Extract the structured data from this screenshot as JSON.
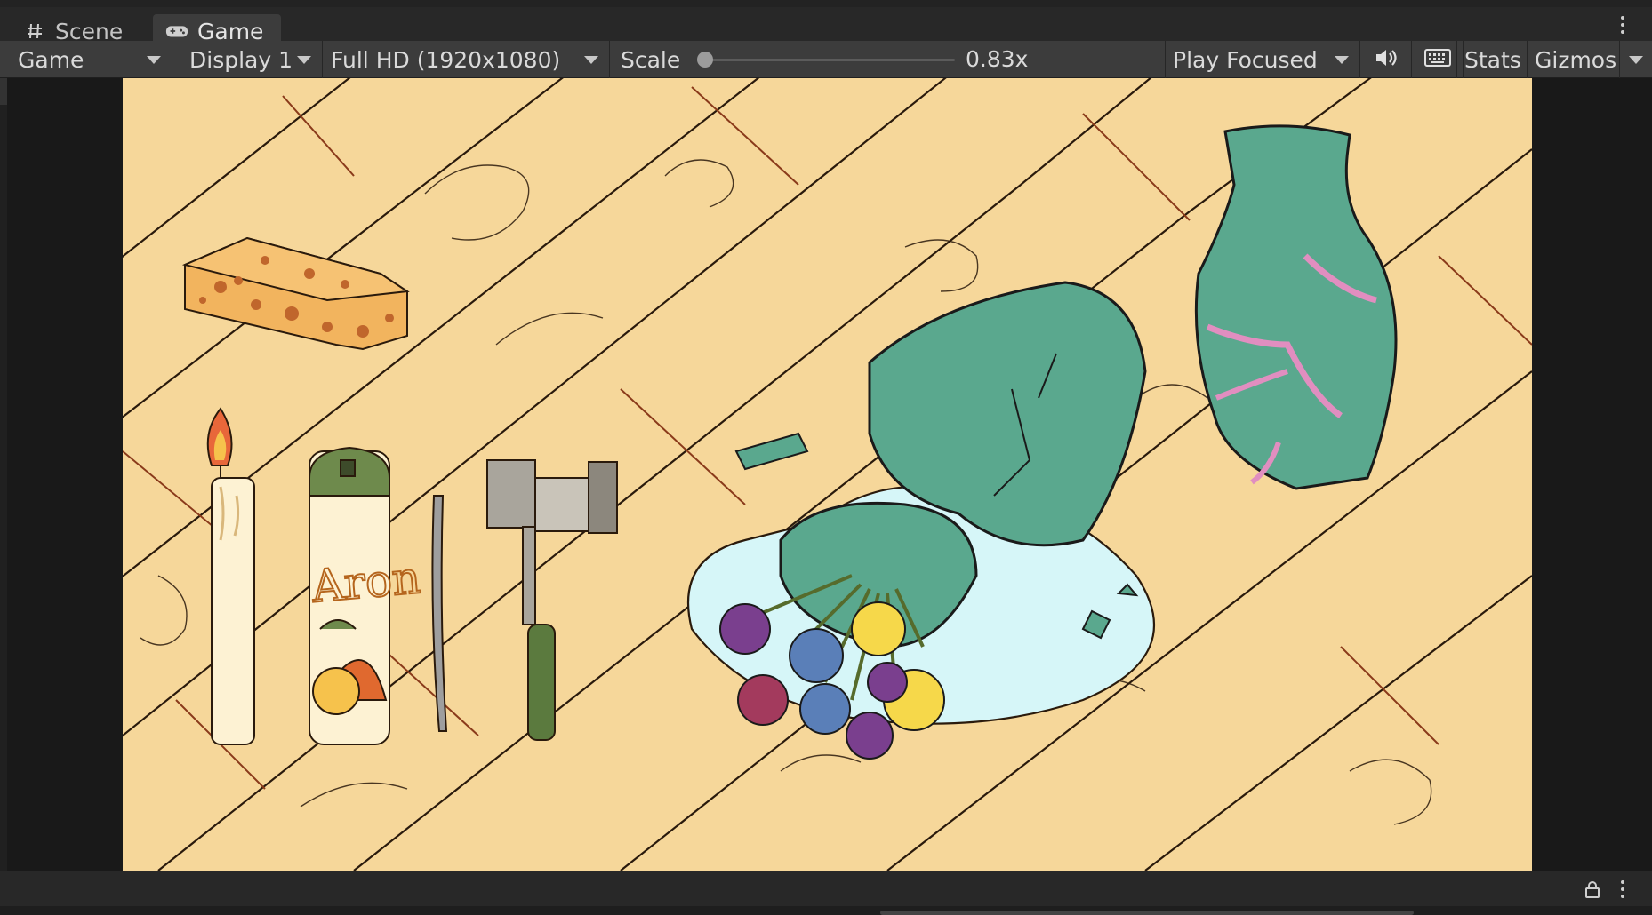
{
  "tabs": {
    "scene_label": "Scene",
    "game_label": "Game"
  },
  "toolbar": {
    "view_select": "Game",
    "display_select": "Display 1",
    "resolution_select": "Full HD (1920x1080)",
    "scale_label": "Scale",
    "scale_value": 0.83,
    "scale_text": "0.83x",
    "play_mode_select": "Play Focused",
    "stats_label": "Stats",
    "gizmos_label": "Gizmos"
  },
  "scene_objects": {
    "aerosol_label": "Aron"
  },
  "icons": {
    "scene_tab": "grid-hash-icon",
    "game_tab": "gamepad-icon",
    "audio": "speaker-icon",
    "keyboard": "keyboard-icon",
    "lock": "lock-icon",
    "menu": "kebab-menu-icon"
  },
  "colors": {
    "editor_bg": "#191919",
    "toolbar_bg": "#3c3c3c",
    "tab_active": "#3c3c3c",
    "floor": "#f6d79a",
    "vase": "#5aa88e",
    "puddle": "#d6f6f8"
  }
}
